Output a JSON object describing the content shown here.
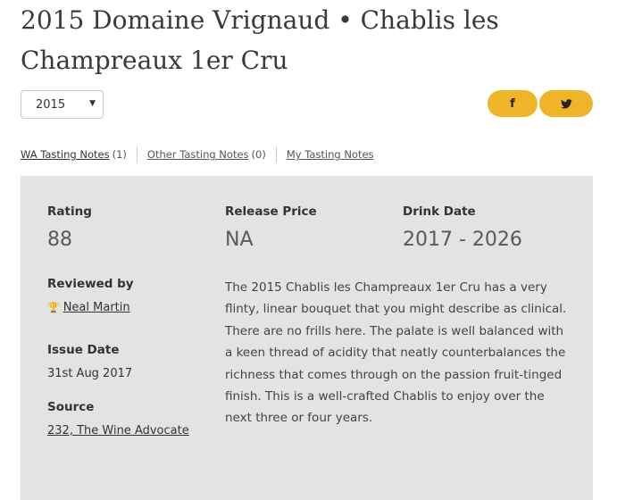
{
  "header": {
    "title": "2015 Domaine Vrignaud • Chablis les Champreaux 1er Cru"
  },
  "vintage_select": {
    "value": "2015"
  },
  "share": {
    "facebook": "f",
    "twitter": "🐦"
  },
  "tabs": [
    {
      "label": "WA Tasting Notes",
      "count": "(1)"
    },
    {
      "label": "Other Tasting Notes",
      "count": "(0)"
    },
    {
      "label": "My Tasting Notes",
      "count": ""
    }
  ],
  "details": {
    "rating_label": "Rating",
    "rating_value": "88",
    "price_label": "Release Price",
    "price_value": "NA",
    "drink_label": "Drink Date",
    "drink_value": "2017 - 2026",
    "reviewed_label": "Reviewed by",
    "reviewer": "Neal Martin",
    "issue_label": "Issue Date",
    "issue_value": "31st Aug 2017",
    "source_label": "Source",
    "source_value": "232, The Wine Advocate"
  },
  "review_text": "The 2015 Chablis les Champreaux 1er Cru has a very flinty, linear bouquet that you might describe as clinical. There are no frills here. The palate is well balanced with a keen thread of acidity that neatly counterbalances the richness that comes through on the passion fruit-tinged finish. This is a well-crafted Chablis to enjoy over the next three or four years.",
  "colors": {
    "accent": "#f0b429",
    "card_bg": "#e3e3e3"
  }
}
